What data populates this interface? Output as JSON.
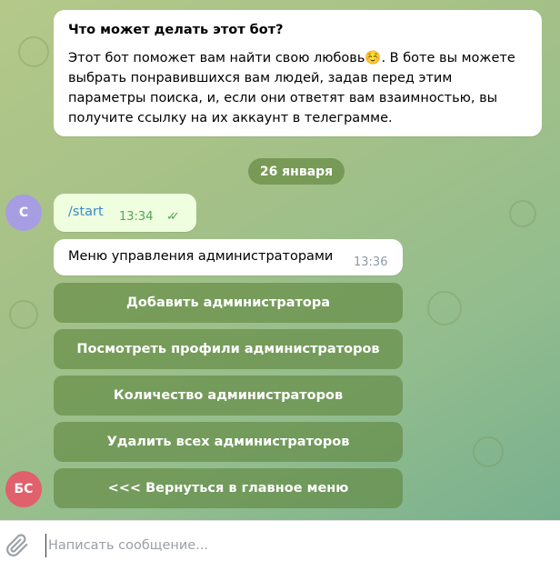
{
  "bot_description": {
    "title": "Что может делать этот бот?",
    "text": "Этот бот поможет вам найти свою любовь☺️. В боте вы можете выбрать понравившихся вам людей, задав перед этим параметры поиска, и, если они ответят вам взаимностью, вы получите ссылку на их аккаунт в телеграмме."
  },
  "date_separator": "26 января",
  "messages": [
    {
      "avatar": "С",
      "text": "/start",
      "time": "13:34",
      "status": "read"
    },
    {
      "text": "Меню управления администраторами",
      "time": "13:36"
    }
  ],
  "keyboard": [
    {
      "label": "Добавить администратора"
    },
    {
      "label": "Посмотреть профили администраторов"
    },
    {
      "label": "Количество администраторов"
    },
    {
      "label": "Удалить всех администраторов"
    },
    {
      "label": "<<< Вернуться в главное меню"
    }
  ],
  "bot_avatar": "БС",
  "colors": {
    "user_avatar": "#a79de2",
    "bot_avatar": "#e0606c",
    "link": "#3a8bc9",
    "read_check": "#5aa35a"
  },
  "composer": {
    "placeholder": "Написать сообщение...",
    "value": ""
  }
}
